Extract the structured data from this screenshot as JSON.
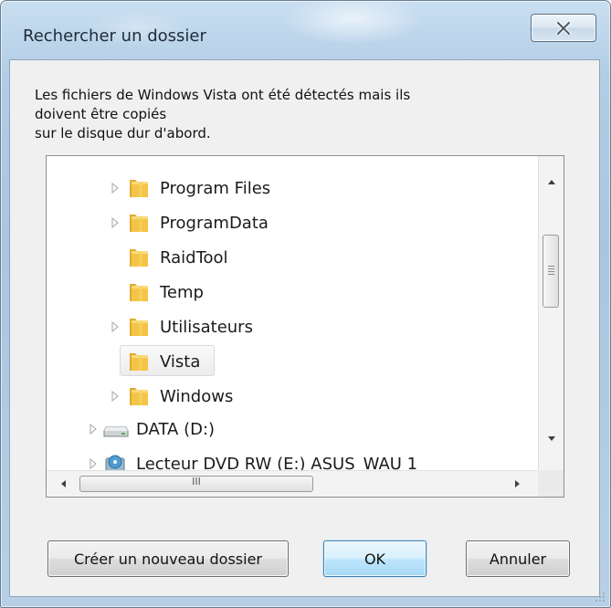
{
  "window": {
    "title": "Rechercher un dossier"
  },
  "message": {
    "line1": "Les fichiers de Windows Vista ont été détectés mais ils",
    "line2": "doivent être copiés",
    "line3": "sur le disque dur d'abord."
  },
  "tree": {
    "items": [
      {
        "label": "Program Files",
        "icon": "folder-icon",
        "expandable": true,
        "selected": false
      },
      {
        "label": "ProgramData",
        "icon": "folder-icon",
        "expandable": true,
        "selected": false
      },
      {
        "label": "RaidTool",
        "icon": "folder-icon",
        "expandable": false,
        "selected": false
      },
      {
        "label": "Temp",
        "icon": "folder-icon",
        "expandable": false,
        "selected": false
      },
      {
        "label": "Utilisateurs",
        "icon": "folder-icon",
        "expandable": true,
        "selected": false
      },
      {
        "label": "Vista",
        "icon": "folder-icon",
        "expandable": false,
        "selected": true
      },
      {
        "label": "Windows",
        "icon": "folder-icon",
        "expandable": true,
        "selected": false
      },
      {
        "label": "DATA (D:)",
        "icon": "hard-drive-icon",
        "expandable": true,
        "selected": false
      },
      {
        "label": "Lecteur DVD RW (E:) ASUS_WAU 1",
        "icon": "dvd-drive-icon",
        "expandable": true,
        "selected": false
      }
    ],
    "hscroll_thumb_glyph": "III"
  },
  "buttons": {
    "new_folder": "Créer un nouveau dossier",
    "ok": "OK",
    "cancel": "Annuler"
  },
  "colors": {
    "title_glass": "#b2cde6",
    "dialog_face": "#f0f0f0",
    "default_button_border": "#3c7fb1",
    "folder_yellow": "#f2c548"
  }
}
